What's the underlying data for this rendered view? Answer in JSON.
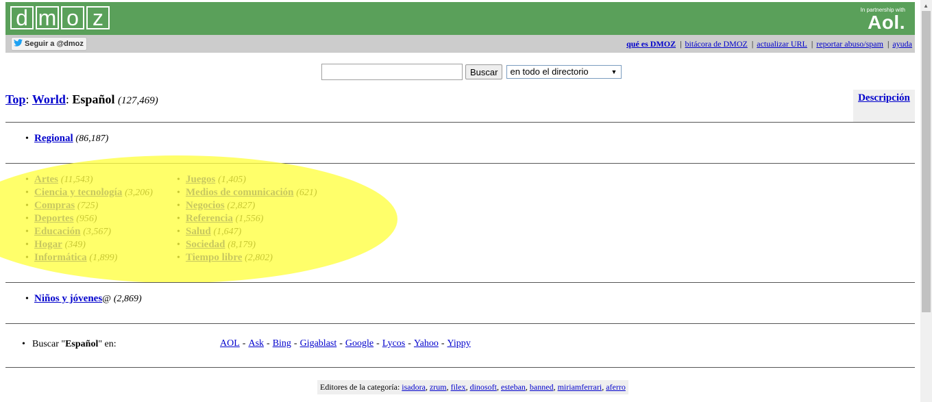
{
  "logo": {
    "letters": [
      "d",
      "m",
      "o",
      "z"
    ]
  },
  "partner": {
    "small": "In partnership with",
    "brand": "Aol."
  },
  "twitter": {
    "label": "Seguir a @dmoz"
  },
  "top_links": [
    "qué es DMOZ",
    "bitácora de DMOZ",
    "actualizar URL",
    "reportar abuso/spam",
    "ayuda"
  ],
  "search": {
    "value": "",
    "button": "Buscar",
    "scope": "en todo el directorio"
  },
  "breadcrumb": {
    "top": "Top",
    "world": "World",
    "current": "Español",
    "count": "(127,469)"
  },
  "description_link": "Descripción",
  "regional": {
    "label": "Regional",
    "count": "(86,187)"
  },
  "categories_col1": [
    {
      "label": "Artes",
      "count": "(11,543)"
    },
    {
      "label": "Ciencia y tecnología",
      "count": "(3,206)"
    },
    {
      "label": "Compras",
      "count": "(725)"
    },
    {
      "label": "Deportes",
      "count": "(956)"
    },
    {
      "label": "Educación",
      "count": "(3,567)"
    },
    {
      "label": "Hogar",
      "count": "(349)"
    },
    {
      "label": "Informática",
      "count": "(1,899)"
    }
  ],
  "categories_col2": [
    {
      "label": "Juegos",
      "count": "(1,405)"
    },
    {
      "label": "Medios de comunicación",
      "count": "(621)"
    },
    {
      "label": "Negocios",
      "count": "(2,827)"
    },
    {
      "label": "Referencia",
      "count": "(1,556)"
    },
    {
      "label": "Salud",
      "count": "(1,647)"
    },
    {
      "label": "Sociedad",
      "count": "(8,179)"
    },
    {
      "label": "Tiempo libre",
      "count": "(2,802)"
    }
  ],
  "kids": {
    "label": "Niños y jóvenes",
    "at": "@",
    "count": "(2,869)"
  },
  "search_other": {
    "prefix": "Buscar \"",
    "term": "Español",
    "suffix": "\" en:"
  },
  "engines": [
    "AOL",
    "Ask",
    "Bing",
    "Gigablast",
    "Google",
    "Lycos",
    "Yahoo",
    "Yippy"
  ],
  "editors": {
    "label": "Editores de la categoría:",
    "names": [
      "isadora",
      "zrum",
      "filex",
      "dinosoft",
      "esteban",
      "banned",
      "miriamferrari",
      "aferro"
    ]
  },
  "colors": {
    "header_green": "#5aa05a",
    "strip_gray": "#cccccc",
    "link": "#0000cc",
    "highlight": "#ffff40"
  }
}
